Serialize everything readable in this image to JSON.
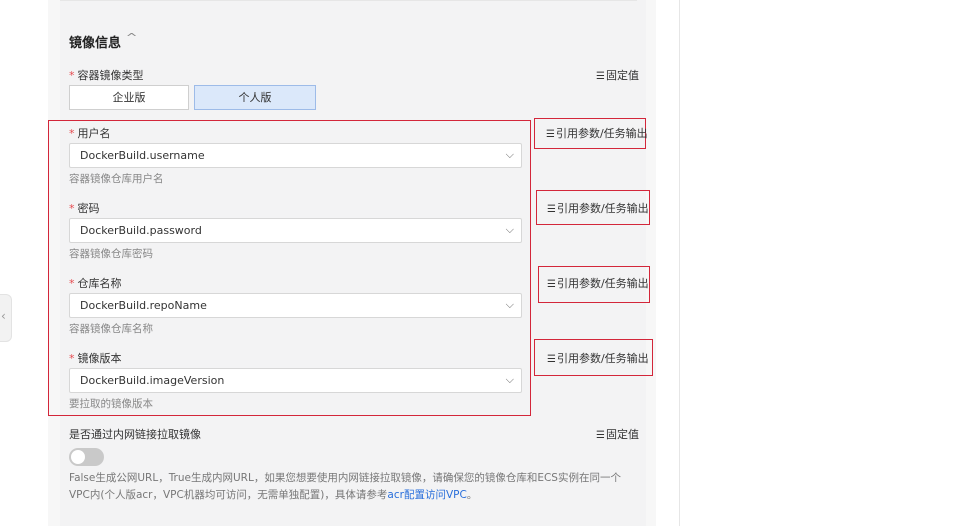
{
  "section": {
    "title": "镜像信息",
    "collapse_icon": "chevron-up-icon"
  },
  "registry_type": {
    "label": "容器镜像类型",
    "required": "*",
    "right_link": "固定值",
    "options": [
      "企业版",
      "个人版"
    ],
    "selected": "个人版"
  },
  "username": {
    "label": "用户名",
    "required": "*",
    "value": "DockerBuild.username",
    "hint": "容器镜像仓库用户名",
    "right_link": "引用参数/任务输出"
  },
  "password": {
    "label": "密码",
    "required": "*",
    "value": "DockerBuild.password",
    "hint": "容器镜像仓库密码",
    "right_link": "引用参数/任务输出"
  },
  "repo": {
    "label": "仓库名称",
    "required": "*",
    "value": "DockerBuild.repoName",
    "hint": "容器镜像仓库名称",
    "right_link": "引用参数/任务输出"
  },
  "image_version": {
    "label": "镜像版本",
    "required": "*",
    "value": "DockerBuild.imageVersion",
    "hint": "要拉取的镜像版本",
    "right_link": "引用参数/任务输出"
  },
  "intranet": {
    "label": "是否通过内网链接拉取镜像",
    "right_link": "固定值",
    "toggle_on": false,
    "description": "False生成公网URL，True生成内网URL，如果您想要使用内网链接拉取镜像，请确保您的镜像仓库和ECS实例在同一个VPC内(个人版acr，VPC机器均可访问，无需单独配置)，具体请参考",
    "link_text": "acr配置访问VPC",
    "description_end": "。"
  },
  "icons": {
    "list": "☰",
    "chevron_down": "⌵",
    "chevron_up": "^",
    "collapse_left": "‹"
  },
  "colors": {
    "highlight_red": "#d3263a",
    "active_segment": "#dbe8fa",
    "link_blue": "#2a6fdb",
    "required_red": "#e5484d"
  }
}
